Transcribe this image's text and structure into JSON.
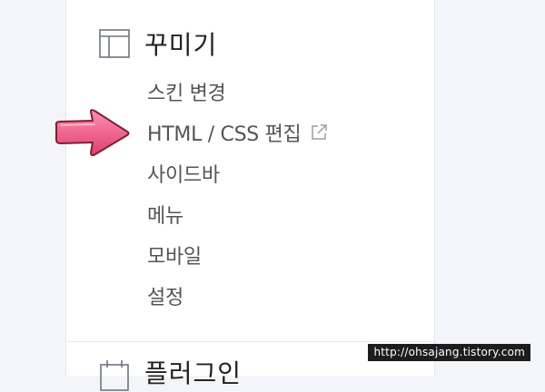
{
  "section": {
    "title": "꾸미기",
    "icon": "layout-icon"
  },
  "menu": [
    {
      "label": "스킨 변경"
    },
    {
      "label": "HTML / CSS 편집",
      "icon": "external-link-icon"
    },
    {
      "label": "사이드바"
    },
    {
      "label": "메뉴"
    },
    {
      "label": "모바일"
    },
    {
      "label": "설정"
    }
  ],
  "next_section": {
    "title": "플러그인",
    "icon": "calendar-icon"
  },
  "annotation": {
    "arrow_color": "#f0557f"
  },
  "watermark": "http://ohsajang.tistory.com"
}
